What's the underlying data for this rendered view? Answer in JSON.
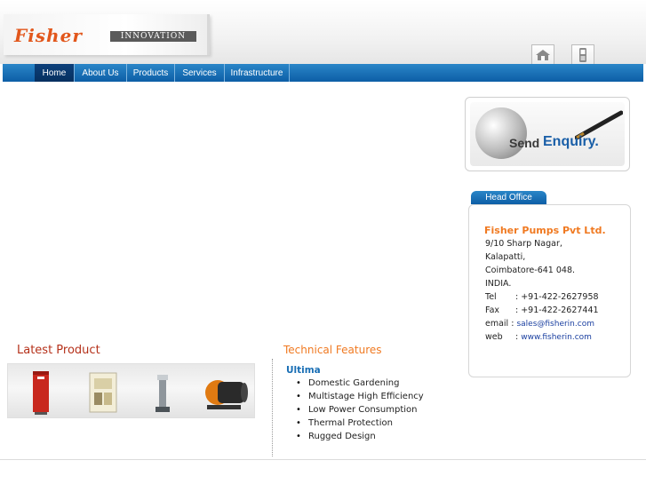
{
  "header": {
    "logo_text": "Fisher",
    "logo_tagline": "INNOVATION",
    "brand_color": "#e2571c",
    "icons": [
      "home-icon",
      "mobile-phone-icon"
    ]
  },
  "nav": {
    "items": [
      {
        "label": "Home"
      },
      {
        "label": "About Us"
      },
      {
        "label": "Products"
      },
      {
        "label": "Services"
      },
      {
        "label": "Infrastructure"
      }
    ],
    "active": "Home"
  },
  "enquiry": {
    "send": "Send",
    "enquiry": "Enquiry."
  },
  "head_office": {
    "tab_label": "Head Office",
    "company": "Fisher Pumps Pvt Ltd.",
    "address": [
      "9/10 Sharp Nagar,",
      "Kalapatti,",
      "Coimbatore-641 048.",
      "INDIA."
    ],
    "contacts": [
      {
        "label": "Tel",
        "value": ": +91-422-2627958"
      },
      {
        "label": "Fax",
        "value": ": +91-422-2627441"
      },
      {
        "label": "email",
        "value": "sales@fisherin.com"
      },
      {
        "label": "web",
        "value": "www.fisherin.com"
      }
    ]
  },
  "latest_product": {
    "title": "Latest Product"
  },
  "technical_features": {
    "title": "Technical Features",
    "product_name": "Ultima",
    "items": [
      "Domestic Gardening",
      "Multistage High Efficiency",
      "Low Power Consumption",
      "Thermal Protection",
      "Rugged Design"
    ]
  }
}
